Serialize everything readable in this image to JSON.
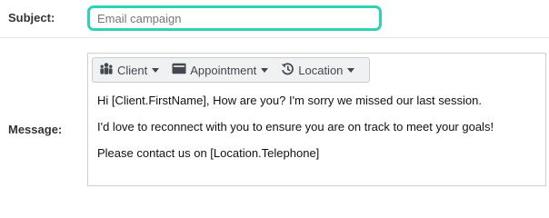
{
  "subject": {
    "label": "Subject:",
    "placeholder": "Email campaign",
    "value": ""
  },
  "message": {
    "label": "Message:",
    "toolbar": {
      "items": [
        {
          "label": "Client",
          "icon": "people-icon"
        },
        {
          "label": "Appointment",
          "icon": "card-icon"
        },
        {
          "label": "Location",
          "icon": "history-clock-icon"
        }
      ]
    },
    "body": [
      "Hi [Client.FirstName], How are you? I'm sorry we missed our last session.",
      "I'd love to reconnect with you to ensure you are on track to meet your goals!",
      "Please contact us on [Location.Telephone]"
    ]
  },
  "colors": {
    "accent": "#2fd2b3",
    "toolbar_bg": "#f0f1f3"
  }
}
